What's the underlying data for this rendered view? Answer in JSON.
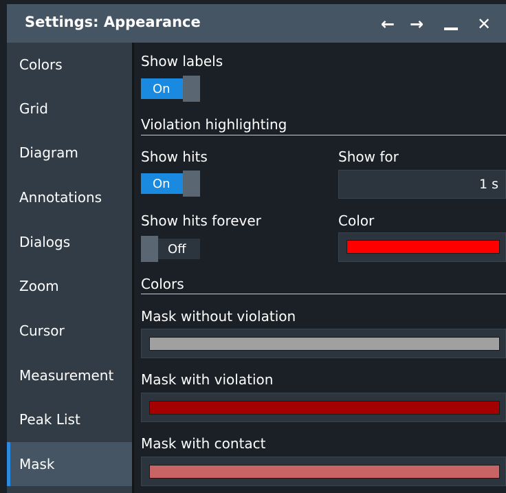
{
  "window": {
    "title": "Settings: Appearance"
  },
  "titlebar_icons": [
    "back-arrow-icon",
    "forward-arrow-icon",
    "minimize-icon",
    "close-icon"
  ],
  "glyphs": {
    "back": "←",
    "forward": "→",
    "close": "✕"
  },
  "sidebar": {
    "items": [
      {
        "label": "Colors"
      },
      {
        "label": "Grid"
      },
      {
        "label": "Diagram"
      },
      {
        "label": "Annotations"
      },
      {
        "label": "Dialogs"
      },
      {
        "label": "Zoom"
      },
      {
        "label": "Cursor"
      },
      {
        "label": "Measurement"
      },
      {
        "label": "Peak List"
      },
      {
        "label": "Mask"
      }
    ],
    "active": "Mask"
  },
  "content": {
    "show_labels": {
      "label": "Show labels",
      "state": "On"
    },
    "violation_section": "Violation highlighting",
    "show_hits": {
      "label": "Show hits",
      "state": "On"
    },
    "show_for": {
      "label": "Show for",
      "value": "1 s"
    },
    "show_hits_forever": {
      "label": "Show hits forever",
      "state": "Off"
    },
    "color": {
      "label": "Color",
      "value": "#ff0000"
    },
    "colors_section": "Colors",
    "mask_without_violation": {
      "label": "Mask without violation",
      "value": "#a0a0a0"
    },
    "mask_with_violation": {
      "label": "Mask with violation",
      "value": "#a50000"
    },
    "mask_with_contact": {
      "label": "Mask with contact",
      "value": "#c86464"
    }
  },
  "colors": {
    "accent": "#1a8ae0",
    "titlebar": "#465563",
    "sidebar": "#313c46",
    "background": "#1b2026"
  }
}
